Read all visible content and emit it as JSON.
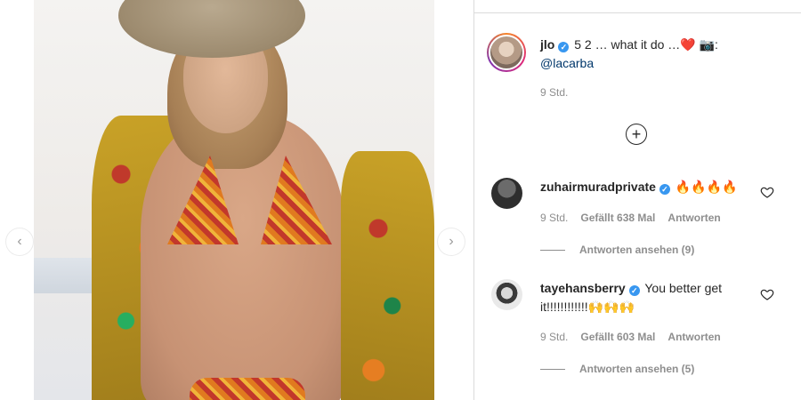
{
  "post": {
    "username": "jlo",
    "caption_text": "5 2 … what it do …❤️ 📷:",
    "caption_mention": "@lacarba",
    "time": "9 Std.",
    "load_more_symbol": "+"
  },
  "comments": [
    {
      "username": "zuhairmuradprivate",
      "text": "🔥🔥🔥🔥",
      "time": "9 Std.",
      "likes": "Gefällt 638 Mal",
      "reply_label": "Antworten",
      "view_replies": "Antworten ansehen (9)"
    },
    {
      "username": "tayehansberry",
      "text": "You better get it!!!!!!!!!!!!🙌🙌🙌",
      "time": "9 Std.",
      "likes": "Gefällt 603 Mal",
      "reply_label": "Antworten",
      "view_replies": "Antworten ansehen (5)"
    }
  ],
  "carousel": {
    "prev_symbol": "‹",
    "next_symbol": "›"
  },
  "verified_symbol": "✓",
  "colors": {
    "verified": "#3897f0",
    "mention": "#00376b",
    "muted": "#8e8e8e"
  }
}
